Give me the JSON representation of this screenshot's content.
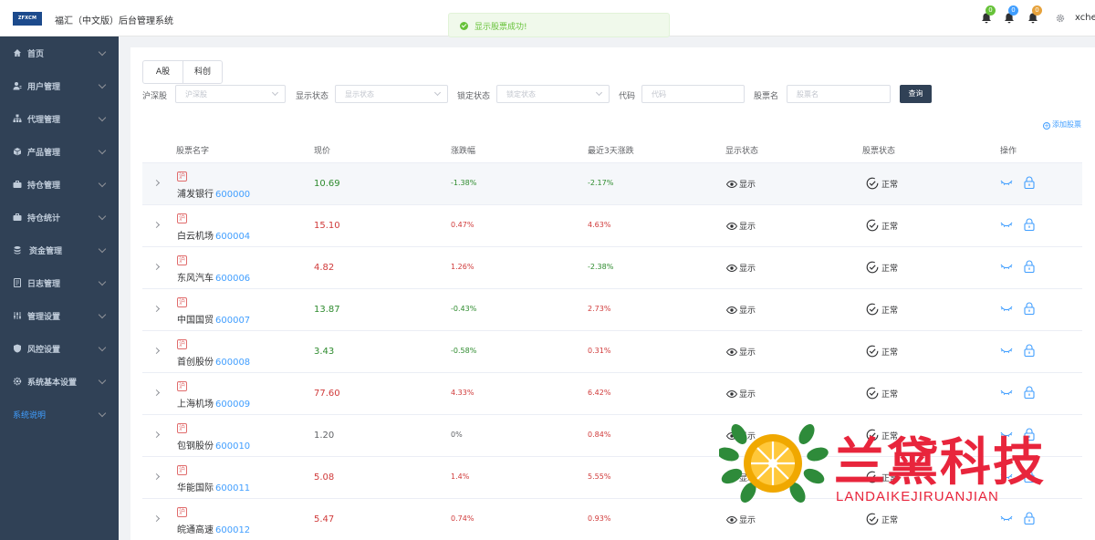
{
  "header": {
    "logo_text": "ZFXCM",
    "app_title": "福汇（中文版）后台管理系统",
    "toast": "显示股票成功!",
    "notifications": [
      {
        "count": "0",
        "color": "#67c23a"
      },
      {
        "count": "0",
        "color": "#409eff"
      },
      {
        "count": "0",
        "color": "#e6a23c"
      }
    ],
    "username": "xcher"
  },
  "sidebar": {
    "items": [
      {
        "label": "首页",
        "icon": "home-icon"
      },
      {
        "label": "用户管理",
        "icon": "user-icon"
      },
      {
        "label": "代理管理",
        "icon": "org-chart-icon"
      },
      {
        "label": "产品管理",
        "icon": "box-icon"
      },
      {
        "label": "持仓管理",
        "icon": "briefcase-icon"
      },
      {
        "label": "持仓统计",
        "icon": "stats-icon"
      },
      {
        "label": "资金管理",
        "icon": "money-icon"
      },
      {
        "label": "日志管理",
        "icon": "log-icon"
      },
      {
        "label": "管理设置",
        "icon": "sliders-icon"
      },
      {
        "label": "风控设置",
        "icon": "shield-icon"
      },
      {
        "label": "系统基本设置",
        "icon": "gear-icon"
      },
      {
        "label": "系统说明",
        "icon": ""
      }
    ]
  },
  "tabs": [
    "A股",
    "科创"
  ],
  "filters": {
    "market_label": "沪深股",
    "market_placeholder": "沪深股",
    "display_label": "显示状态",
    "display_placeholder": "显示状态",
    "lock_label": "锁定状态",
    "lock_placeholder": "锁定状态",
    "code_label": "代码",
    "code_placeholder": "代码",
    "name_label": "股票名",
    "name_placeholder": "股票名",
    "query": "查询"
  },
  "add_stock": "添加股票",
  "columns": [
    "股票名字",
    "现价",
    "涨跌幅",
    "最近3天涨跌",
    "显示状态",
    "股票状态",
    "操作"
  ],
  "rows": [
    {
      "market": "沪",
      "name": "浦发银行",
      "code": "600000",
      "price": "10.69",
      "change": "-1.38%",
      "change3d": "-2.17%",
      "display": "显示",
      "status": "正常"
    },
    {
      "market": "沪",
      "name": "白云机场",
      "code": "600004",
      "price": "15.10",
      "change": "0.47%",
      "change3d": "4.63%",
      "display": "显示",
      "status": "正常"
    },
    {
      "market": "沪",
      "name": "东风汽车",
      "code": "600006",
      "price": "4.82",
      "change": "1.26%",
      "change3d": "-2.38%",
      "display": "显示",
      "status": "正常"
    },
    {
      "market": "沪",
      "name": "中国国贸",
      "code": "600007",
      "price": "13.87",
      "change": "-0.43%",
      "change3d": "2.73%",
      "display": "显示",
      "status": "正常"
    },
    {
      "market": "沪",
      "name": "首创股份",
      "code": "600008",
      "price": "3.43",
      "change": "-0.58%",
      "change3d": "0.31%",
      "display": "显示",
      "status": "正常"
    },
    {
      "market": "沪",
      "name": "上海机场",
      "code": "600009",
      "price": "77.60",
      "change": "4.33%",
      "change3d": "6.42%",
      "display": "显示",
      "status": "正常"
    },
    {
      "market": "沪",
      "name": "包钢股份",
      "code": "600010",
      "price": "1.20",
      "change": "0%",
      "change3d": "0.84%",
      "display": "显示",
      "status": "正常"
    },
    {
      "market": "沪",
      "name": "华能国际",
      "code": "600011",
      "price": "5.08",
      "change": "1.4%",
      "change3d": "5.55%",
      "display": "显示",
      "status": "正常"
    },
    {
      "market": "沪",
      "name": "皖通高速",
      "code": "600012",
      "price": "5.47",
      "change": "0.74%",
      "change3d": "0.93%",
      "display": "显示",
      "status": "正常"
    }
  ],
  "watermark": {
    "title": "兰黛科技",
    "subtitle": "LANDAIKEJIRUANJIAN"
  }
}
